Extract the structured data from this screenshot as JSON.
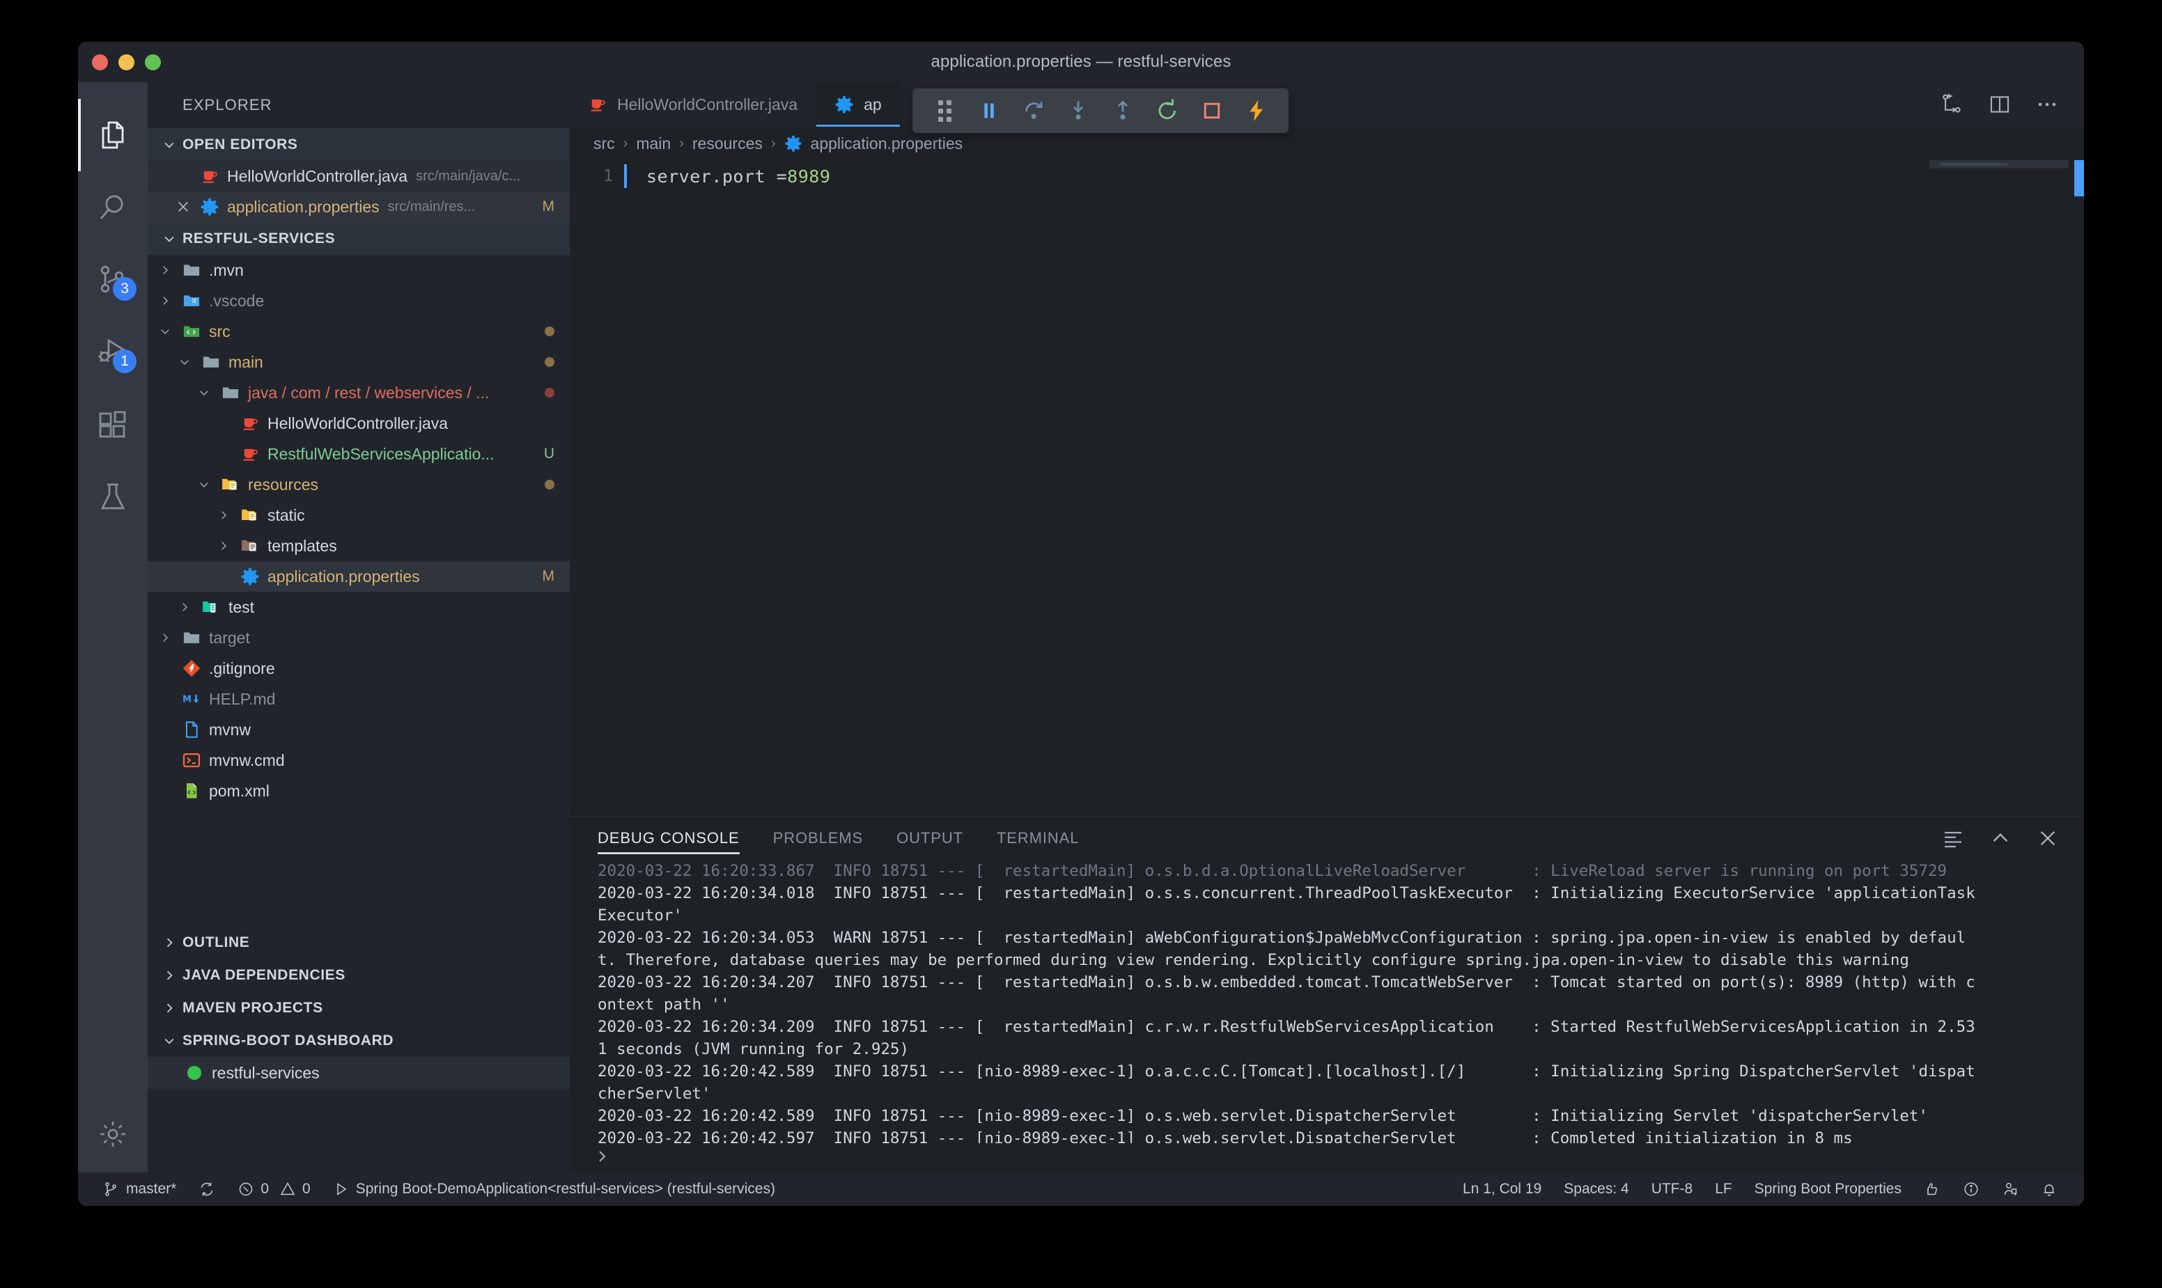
{
  "window": {
    "title": "application.properties — restful-services"
  },
  "activity_bar": {
    "items": [
      {
        "name": "explorer",
        "icon": "files-icon",
        "badge": ""
      },
      {
        "name": "search",
        "icon": "search-icon",
        "badge": ""
      },
      {
        "name": "source-control",
        "icon": "source-control-icon",
        "badge": "3"
      },
      {
        "name": "run-debug",
        "icon": "run-debug-icon",
        "badge": "1"
      },
      {
        "name": "extensions",
        "icon": "extensions-icon",
        "badge": ""
      },
      {
        "name": "testing",
        "icon": "beaker-icon",
        "badge": ""
      }
    ],
    "manage": {
      "icon": "gear-icon",
      "label": "Manage"
    }
  },
  "sidebar": {
    "title": "EXPLORER",
    "open_editors": {
      "header": "OPEN EDITORS",
      "items": [
        {
          "name": "HelloWorldController.java",
          "path": "src/main/java/c...",
          "mark": "",
          "icon": "java-icon",
          "color": "white",
          "selected": false,
          "closable": false
        },
        {
          "name": "application.properties",
          "path": "src/main/res...",
          "mark": "M",
          "icon": "properties-icon",
          "color": "amber",
          "selected": true,
          "closable": true
        }
      ]
    },
    "project": {
      "header": "RESTFUL-SERVICES",
      "tree": [
        {
          "label": ".mvn",
          "depth": 1,
          "twisty": "right",
          "icon": "folder-gray-icon",
          "color": "white",
          "mark": "",
          "dot": ""
        },
        {
          "label": ".vscode",
          "depth": 1,
          "twisty": "right",
          "icon": "vscode-folder-icon",
          "color": "dim",
          "mark": "",
          "dot": ""
        },
        {
          "label": "src",
          "depth": 1,
          "twisty": "down",
          "icon": "folder-src-icon",
          "color": "amber",
          "mark": "",
          "dot": "#8a7249"
        },
        {
          "label": "main",
          "depth": 2,
          "twisty": "down",
          "icon": "folder-open-icon",
          "color": "amber",
          "mark": "",
          "dot": "#8a7249"
        },
        {
          "label": "java / com / rest / webservices / ...",
          "depth": 3,
          "twisty": "down",
          "icon": "folder-open-icon",
          "color": "redf",
          "mark": "",
          "dot": "#8a4038"
        },
        {
          "label": "HelloWorldController.java",
          "depth": 4,
          "twisty": "none",
          "icon": "java-icon",
          "color": "white",
          "mark": "",
          "dot": ""
        },
        {
          "label": "RestfulWebServicesApplicatio...",
          "depth": 4,
          "twisty": "none",
          "icon": "java-icon",
          "color": "greenf",
          "mark": "U",
          "dot": ""
        },
        {
          "label": "resources",
          "depth": 3,
          "twisty": "down",
          "icon": "folder-res-icon",
          "color": "amber",
          "mark": "",
          "dot": "#8a7249"
        },
        {
          "label": "static",
          "depth": 4,
          "twisty": "right",
          "icon": "folder-res-icon",
          "color": "white",
          "mark": "",
          "dot": ""
        },
        {
          "label": "templates",
          "depth": 4,
          "twisty": "right",
          "icon": "folder-tpl-icon",
          "color": "white",
          "mark": "",
          "dot": ""
        },
        {
          "label": "application.properties",
          "depth": 4,
          "twisty": "none",
          "icon": "properties-icon",
          "color": "amber",
          "mark": "M",
          "dot": "",
          "selected": true
        },
        {
          "label": "test",
          "depth": 2,
          "twisty": "right",
          "icon": "folder-test-icon",
          "color": "white",
          "mark": "",
          "dot": ""
        },
        {
          "label": "target",
          "depth": 1,
          "twisty": "right",
          "icon": "folder-gray-icon",
          "color": "dim",
          "mark": "",
          "dot": ""
        },
        {
          "label": ".gitignore",
          "depth": 1,
          "twisty": "none",
          "icon": "git-icon",
          "color": "white",
          "mark": "",
          "dot": ""
        },
        {
          "label": "HELP.md",
          "depth": 1,
          "twisty": "none",
          "icon": "markdown-icon",
          "color": "dim",
          "mark": "",
          "dot": ""
        },
        {
          "label": "mvnw",
          "depth": 1,
          "twisty": "none",
          "icon": "file-icon",
          "color": "white",
          "mark": "",
          "dot": ""
        },
        {
          "label": "mvnw.cmd",
          "depth": 1,
          "twisty": "none",
          "icon": "terminal-file-icon",
          "color": "white",
          "mark": "",
          "dot": ""
        },
        {
          "label": "pom.xml",
          "depth": 1,
          "twisty": "none",
          "icon": "xml-icon",
          "color": "white",
          "mark": "",
          "dot": ""
        }
      ]
    },
    "sections": [
      {
        "label": "OUTLINE",
        "expanded": false
      },
      {
        "label": "JAVA DEPENDENCIES",
        "expanded": false
      },
      {
        "label": "MAVEN PROJECTS",
        "expanded": false
      },
      {
        "label": "SPRING-BOOT DASHBOARD",
        "expanded": true
      }
    ],
    "dashboard_items": [
      {
        "label": "restful-services",
        "status_color": "#35c44b"
      }
    ]
  },
  "editor": {
    "tabs": [
      {
        "label": "HelloWorldController.java",
        "icon": "java-icon",
        "active": false
      },
      {
        "label": "application.properties",
        "icon": "properties-icon",
        "active": true,
        "truncated": "ap"
      }
    ],
    "actions": [
      {
        "name": "split-editor-flow-icon"
      },
      {
        "name": "split-editor-icon"
      },
      {
        "name": "more-actions-icon"
      }
    ],
    "breadcrumb": [
      "src",
      "main",
      "resources",
      "application.properties"
    ],
    "breadcrumb_separator": "›",
    "code": {
      "line_number": "1",
      "text": "server.port = ",
      "value": "8989"
    }
  },
  "debug_toolbar": {
    "buttons": [
      {
        "name": "drag-handle-icon",
        "label": "Drag"
      },
      {
        "name": "pause-icon",
        "label": "Pause",
        "color": "#5aa7f0"
      },
      {
        "name": "step-over-icon",
        "label": "Step Over",
        "color": "#6b8dab"
      },
      {
        "name": "step-into-icon",
        "label": "Step Into",
        "color": "#6b8dab"
      },
      {
        "name": "step-out-icon",
        "label": "Step Out",
        "color": "#6b8dab"
      },
      {
        "name": "restart-icon",
        "label": "Restart",
        "color": "#7fc98a"
      },
      {
        "name": "stop-icon",
        "label": "Stop",
        "color": "#f08070"
      },
      {
        "name": "hot-reload-icon",
        "label": "Hot Reload",
        "color": "#f5a623"
      }
    ]
  },
  "panel": {
    "tabs": [
      {
        "label": "DEBUG CONSOLE",
        "active": true
      },
      {
        "label": "PROBLEMS",
        "active": false
      },
      {
        "label": "OUTPUT",
        "active": false
      },
      {
        "label": "TERMINAL",
        "active": false
      }
    ],
    "actions": [
      {
        "name": "clear-console-icon"
      },
      {
        "name": "maximize-panel-icon"
      },
      {
        "name": "close-panel-icon"
      }
    ],
    "console_lines": [
      {
        "text": "2020-03-22 16:20:33.867  INFO 18751 --- [  restartedMain] o.s.b.d.a.OptionalLiveReloadServer       : LiveReload server is running on port 35729",
        "dim": true
      },
      {
        "text": "2020-03-22 16:20:34.018  INFO 18751 --- [  restartedMain] o.s.s.concurrent.ThreadPoolTaskExecutor  : Initializing ExecutorService 'applicationTask",
        "dim": false
      },
      {
        "text": "Executor'",
        "dim": false
      },
      {
        "text": "2020-03-22 16:20:34.053  WARN 18751 --- [  restartedMain] aWebConfiguration$JpaWebMvcConfiguration : spring.jpa.open-in-view is enabled by defaul",
        "dim": false
      },
      {
        "text": "t. Therefore, database queries may be performed during view rendering. Explicitly configure spring.jpa.open-in-view to disable this warning",
        "dim": false
      },
      {
        "text": "2020-03-22 16:20:34.207  INFO 18751 --- [  restartedMain] o.s.b.w.embedded.tomcat.TomcatWebServer  : Tomcat started on port(s): 8989 (http) with c",
        "dim": false
      },
      {
        "text": "ontext path ''",
        "dim": false
      },
      {
        "text": "2020-03-22 16:20:34.209  INFO 18751 --- [  restartedMain] c.r.w.r.RestfulWebServicesApplication    : Started RestfulWebServicesApplication in 2.53",
        "dim": false
      },
      {
        "text": "1 seconds (JVM running for 2.925)",
        "dim": false
      },
      {
        "text": "2020-03-22 16:20:42.589  INFO 18751 --- [nio-8989-exec-1] o.a.c.c.C.[Tomcat].[localhost].[/]       : Initializing Spring DispatcherServlet 'dispat",
        "dim": false
      },
      {
        "text": "cherServlet'",
        "dim": false
      },
      {
        "text": "2020-03-22 16:20:42.589  INFO 18751 --- [nio-8989-exec-1] o.s.web.servlet.DispatcherServlet        : Initializing Servlet 'dispatcherServlet'",
        "dim": false
      },
      {
        "text": "2020-03-22 16:20:42.597  INFO 18751 --- [nio-8989-exec-1] o.s.web.servlet.DispatcherServlet        : Completed initialization in 8 ms",
        "dim": false
      }
    ]
  },
  "status_bar": {
    "branch": "master*",
    "sync_icon": "sync-icon",
    "errors": "0",
    "warnings": "0",
    "run_config": "Spring Boot-DemoApplication<restful-services> (restful-services)",
    "position": "Ln 1, Col 19",
    "spaces": "Spaces: 4",
    "encoding": "UTF-8",
    "eol": "LF",
    "language": "Spring Boot Properties",
    "right_icons": [
      "feedback-icon",
      "info-icon",
      "remote-icon",
      "bell-icon"
    ]
  }
}
